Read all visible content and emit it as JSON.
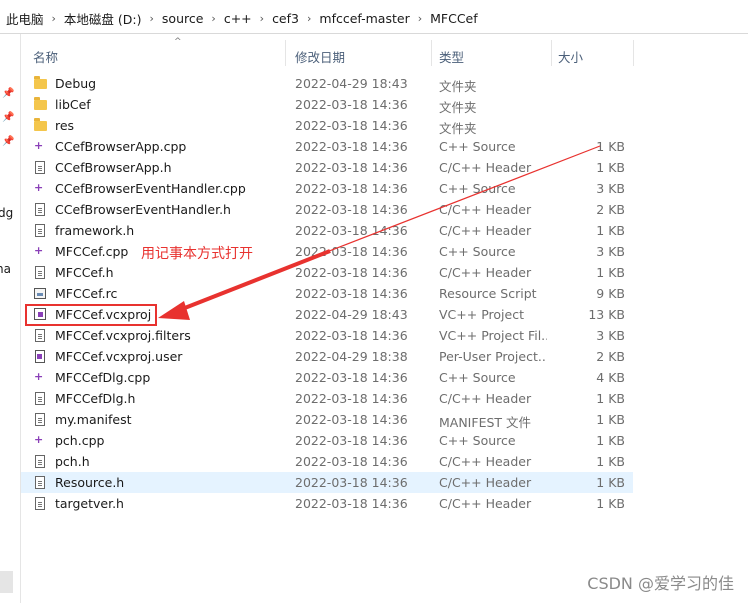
{
  "breadcrumb": [
    "此电脑",
    "本地磁盘 (D:)",
    "source",
    "c++",
    "cef3",
    "mfccef-master",
    "MFCCef"
  ],
  "columns": {
    "name": "名称",
    "modified": "修改日期",
    "type": "类型",
    "size": "大小"
  },
  "nav_fragments": [
    "dg",
    "na"
  ],
  "files": [
    {
      "name": "Debug",
      "date": "2022-04-29 18:43",
      "type": "文件夹",
      "size": "",
      "icon": "folder-icon"
    },
    {
      "name": "libCef",
      "date": "2022-03-18 14:36",
      "type": "文件夹",
      "size": "",
      "icon": "folder-icon"
    },
    {
      "name": "res",
      "date": "2022-03-18 14:36",
      "type": "文件夹",
      "size": "",
      "icon": "folder-icon"
    },
    {
      "name": "CCefBrowserApp.cpp",
      "date": "2022-03-18 14:36",
      "type": "C++ Source",
      "size": "1 KB",
      "icon": "cpp-file-icon"
    },
    {
      "name": "CCefBrowserApp.h",
      "date": "2022-03-18 14:36",
      "type": "C/C++ Header",
      "size": "1 KB",
      "icon": "header-file-icon"
    },
    {
      "name": "CCefBrowserEventHandler.cpp",
      "date": "2022-03-18 14:36",
      "type": "C++ Source",
      "size": "3 KB",
      "icon": "cpp-file-icon"
    },
    {
      "name": "CCefBrowserEventHandler.h",
      "date": "2022-03-18 14:36",
      "type": "C/C++ Header",
      "size": "2 KB",
      "icon": "header-file-icon"
    },
    {
      "name": "framework.h",
      "date": "2022-03-18 14:36",
      "type": "C/C++ Header",
      "size": "1 KB",
      "icon": "header-file-icon"
    },
    {
      "name": "MFCCef.cpp",
      "date": "2022-03-18 14:36",
      "type": "C++ Source",
      "size": "3 KB",
      "icon": "cpp-file-icon"
    },
    {
      "name": "MFCCef.h",
      "date": "2022-03-18 14:36",
      "type": "C/C++ Header",
      "size": "1 KB",
      "icon": "header-file-icon"
    },
    {
      "name": "MFCCef.rc",
      "date": "2022-03-18 14:36",
      "type": "Resource Script",
      "size": "9 KB",
      "icon": "resource-script-icon"
    },
    {
      "name": "MFCCef.vcxproj",
      "date": "2022-04-29 18:43",
      "type": "VC++ Project",
      "size": "13 KB",
      "icon": "vcxproj-icon"
    },
    {
      "name": "MFCCef.vcxproj.filters",
      "date": "2022-03-18 14:36",
      "type": "VC++ Project Fil...",
      "size": "3 KB",
      "icon": "filters-file-icon"
    },
    {
      "name": "MFCCef.vcxproj.user",
      "date": "2022-04-29 18:38",
      "type": "Per-User Project...",
      "size": "2 KB",
      "icon": "user-file-icon"
    },
    {
      "name": "MFCCefDlg.cpp",
      "date": "2022-03-18 14:36",
      "type": "C++ Source",
      "size": "4 KB",
      "icon": "cpp-file-icon"
    },
    {
      "name": "MFCCefDlg.h",
      "date": "2022-03-18 14:36",
      "type": "C/C++ Header",
      "size": "1 KB",
      "icon": "header-file-icon"
    },
    {
      "name": "my.manifest",
      "date": "2022-03-18 14:36",
      "type": "MANIFEST 文件",
      "size": "1 KB",
      "icon": "manifest-file-icon"
    },
    {
      "name": "pch.cpp",
      "date": "2022-03-18 14:36",
      "type": "C++ Source",
      "size": "1 KB",
      "icon": "cpp-file-icon"
    },
    {
      "name": "pch.h",
      "date": "2022-03-18 14:36",
      "type": "C/C++ Header",
      "size": "1 KB",
      "icon": "header-file-icon"
    },
    {
      "name": "Resource.h",
      "date": "2022-03-18 14:36",
      "type": "C/C++ Header",
      "size": "1 KB",
      "icon": "header-file-icon",
      "selected": true
    },
    {
      "name": "targetver.h",
      "date": "2022-03-18 14:36",
      "type": "C/C++ Header",
      "size": "1 KB",
      "icon": "header-file-icon"
    }
  ],
  "annotation": {
    "text": "用记事本方式打开",
    "color": "#e8322f",
    "target": "MFCCef.vcxproj"
  },
  "watermark": "CSDN @爱学习的佳",
  "colors": {
    "selection": "#e5f3ff",
    "folder": "#f4c64c",
    "cpp_icon": "#8a3fb8",
    "header_text": "#4c607a"
  }
}
